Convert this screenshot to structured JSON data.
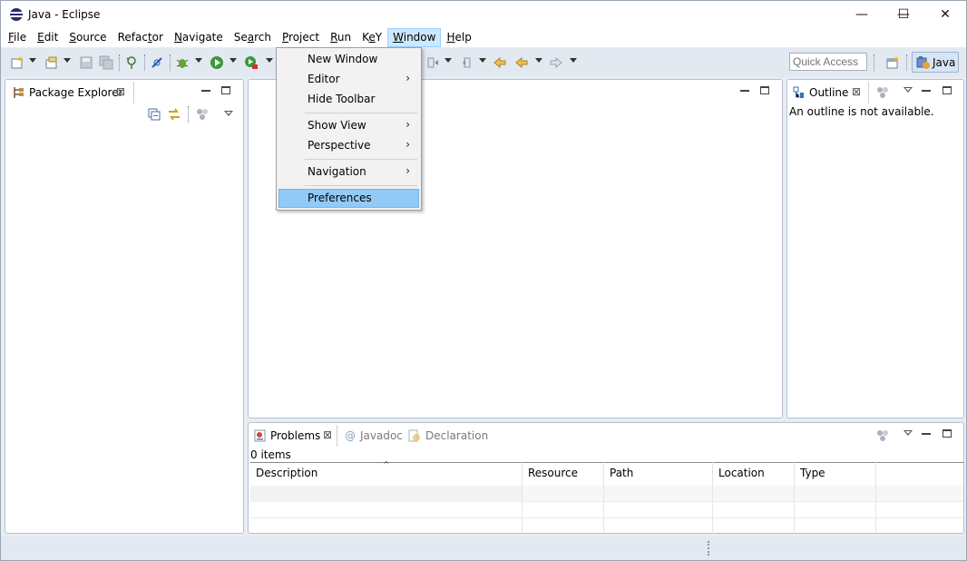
{
  "window": {
    "title": "Java - Eclipse",
    "minimize_glyph": "—",
    "maximize_glyph": "☐",
    "close_glyph": "✕"
  },
  "menubar": {
    "items": [
      {
        "label": "File",
        "underline": "F"
      },
      {
        "label": "Edit",
        "underline": "E"
      },
      {
        "label": "Source",
        "underline": "S"
      },
      {
        "label": "Refactor",
        "underline": "t"
      },
      {
        "label": "Navigate",
        "underline": "N"
      },
      {
        "label": "Search",
        "underline": "a"
      },
      {
        "label": "Project",
        "underline": "P"
      },
      {
        "label": "Run",
        "underline": "R"
      },
      {
        "label": "KeY",
        "underline": "e"
      },
      {
        "label": "Window",
        "underline": "W",
        "active": true
      },
      {
        "label": "Help",
        "underline": "H"
      }
    ]
  },
  "toolbar": {
    "quick_access_placeholder": "Quick Access",
    "perspective_label": "Java"
  },
  "window_menu": {
    "items": [
      {
        "label": "New Window",
        "submenu": false
      },
      {
        "label": "Editor",
        "submenu": true
      },
      {
        "label": "Hide Toolbar",
        "submenu": false
      },
      {
        "label": "Show View",
        "submenu": true
      },
      {
        "label": "Perspective",
        "submenu": true
      },
      {
        "label": "Navigation",
        "submenu": true
      },
      {
        "label": "Preferences",
        "submenu": false,
        "selected": true
      }
    ],
    "arrow_glyph": "›"
  },
  "package_explorer": {
    "tab_label": "Package Explorer"
  },
  "outline": {
    "tab_label": "Outline",
    "message": "An outline is not available."
  },
  "bottom_panel": {
    "tabs": [
      {
        "label": "Problems",
        "active": true
      },
      {
        "label": "Javadoc",
        "active": false
      },
      {
        "label": "Declaration",
        "active": false
      }
    ],
    "item_count": "0 items",
    "columns": [
      "Description",
      "Resource",
      "Path",
      "Location",
      "Type"
    ]
  },
  "colors": {
    "menu_highlight": "#91c9f7",
    "active_menu": "#cce8ff",
    "chrome_bg": "#e3e9f1"
  }
}
